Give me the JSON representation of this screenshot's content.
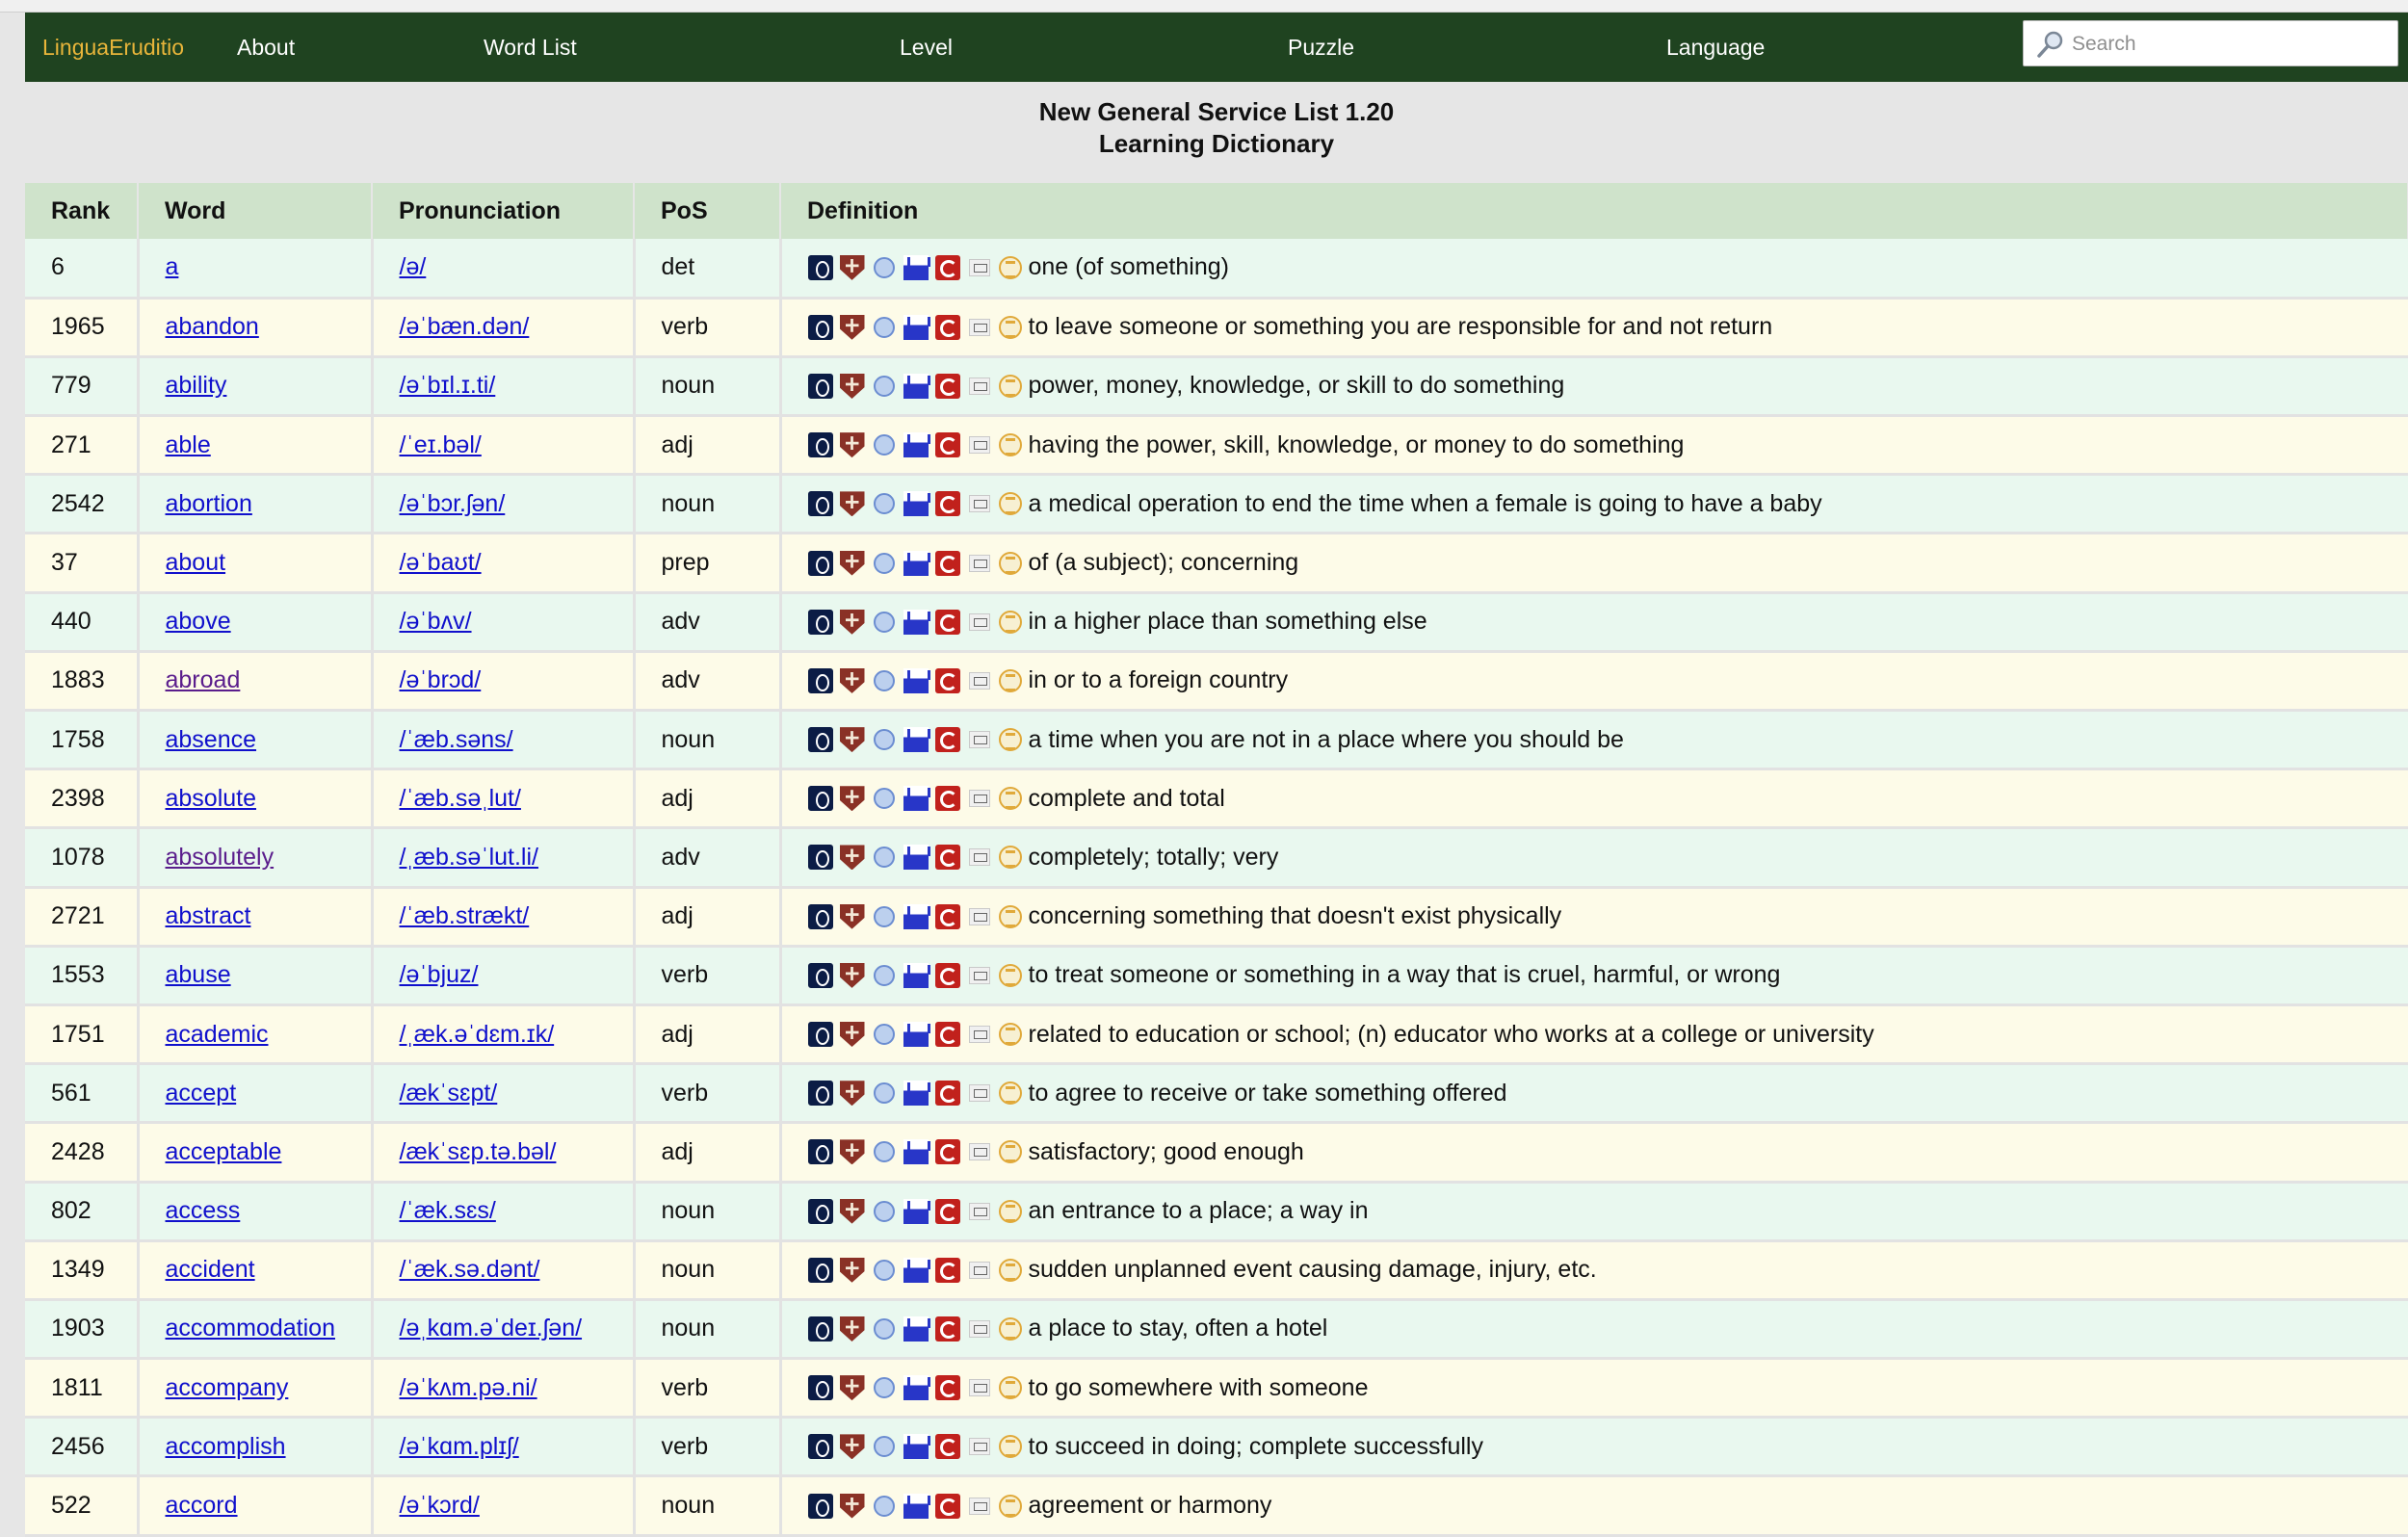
{
  "nav": {
    "brand": "LinguaEruditio",
    "items": [
      "About",
      "Word List",
      "Level",
      "Puzzle",
      "Language"
    ],
    "search_placeholder": "Search"
  },
  "heading": {
    "line1": "New General Service List 1.20",
    "line2": "Learning Dictionary"
  },
  "table": {
    "columns": [
      "Rank",
      "Word",
      "Pronunciation",
      "PoS",
      "Definition"
    ],
    "dictionary_icons": [
      "oxford-icon",
      "cambridge-shield-icon",
      "globe-icon",
      "ship-icon",
      "collins-c-icon",
      "merriam-webster-icon",
      "wordsmyth-s-icon"
    ],
    "rows": [
      {
        "rank": "6",
        "word": "a",
        "pron": "/ə/",
        "pos": "det",
        "def": "one (of something)"
      },
      {
        "rank": "1965",
        "word": "abandon",
        "pron": "/əˈbæn.dən/",
        "pos": "verb",
        "def": "to leave someone or something you are responsible for and not return"
      },
      {
        "rank": "779",
        "word": "ability",
        "pron": "/əˈbɪl.ɪ.ti/",
        "pos": "noun",
        "def": "power, money, knowledge, or skill to do something"
      },
      {
        "rank": "271",
        "word": "able",
        "pron": "/ˈeɪ.bəl/",
        "pos": "adj",
        "def": "having the power, skill, knowledge, or money to do something"
      },
      {
        "rank": "2542",
        "word": "abortion",
        "pron": "/əˈbɔr.ʃən/",
        "pos": "noun",
        "def": "a medical operation to end the time when a female is going to have a baby"
      },
      {
        "rank": "37",
        "word": "about",
        "pron": "/əˈbaʊt/",
        "pos": "prep",
        "def": "of (a subject); concerning"
      },
      {
        "rank": "440",
        "word": "above",
        "pron": "/əˈbʌv/",
        "pos": "adv",
        "def": "in a higher place than something else"
      },
      {
        "rank": "1883",
        "word": "abroad",
        "pron": "/əˈbrɔd/",
        "pos": "adv",
        "def": "in or to a foreign country",
        "visited": true
      },
      {
        "rank": "1758",
        "word": "absence",
        "pron": "/ˈæb.səns/",
        "pos": "noun",
        "def": "a time when you are not in a place where you should be"
      },
      {
        "rank": "2398",
        "word": "absolute",
        "pron": "/ˈæb.səˌlut/",
        "pos": "adj",
        "def": "complete and total"
      },
      {
        "rank": "1078",
        "word": "absolutely",
        "pron": "/ˌæb.səˈlut.li/",
        "pos": "adv",
        "def": "completely; totally; very",
        "visited": true
      },
      {
        "rank": "2721",
        "word": "abstract",
        "pron": "/ˈæb.strækt/",
        "pos": "adj",
        "def": "concerning something that doesn't exist physically"
      },
      {
        "rank": "1553",
        "word": "abuse",
        "pron": "/əˈbjuz/",
        "pos": "verb",
        "def": "to treat someone or something in a way that is cruel, harmful, or wrong"
      },
      {
        "rank": "1751",
        "word": "academic",
        "pron": "/ˌæk.əˈdɛm.ɪk/",
        "pos": "adj",
        "def": "related to education or school; (n) educator who works at a college or university"
      },
      {
        "rank": "561",
        "word": "accept",
        "pron": "/ækˈsɛpt/",
        "pos": "verb",
        "def": "to agree to receive or take something offered"
      },
      {
        "rank": "2428",
        "word": "acceptable",
        "pron": "/ækˈsɛp.tə.bəl/",
        "pos": "adj",
        "def": "satisfactory; good enough"
      },
      {
        "rank": "802",
        "word": "access",
        "pron": "/ˈæk.sɛs/",
        "pos": "noun",
        "def": "an entrance to a place; a way in"
      },
      {
        "rank": "1349",
        "word": "accident",
        "pron": "/ˈæk.sə.dənt/",
        "pos": "noun",
        "def": "sudden unplanned event causing damage, injury, etc."
      },
      {
        "rank": "1903",
        "word": "accommodation",
        "pron": "/əˌkɑm.əˈdeɪ.ʃən/",
        "pos": "noun",
        "def": "a place to stay, often a hotel"
      },
      {
        "rank": "1811",
        "word": "accompany",
        "pron": "/əˈkʌm.pə.ni/",
        "pos": "verb",
        "def": "to go somewhere with someone"
      },
      {
        "rank": "2456",
        "word": "accomplish",
        "pron": "/əˈkɑm.plɪʃ/",
        "pos": "verb",
        "def": "to succeed in doing; complete successfully"
      },
      {
        "rank": "522",
        "word": "accord",
        "pron": "/əˈkɔrd/",
        "pos": "noun",
        "def": "agreement or harmony"
      }
    ]
  }
}
